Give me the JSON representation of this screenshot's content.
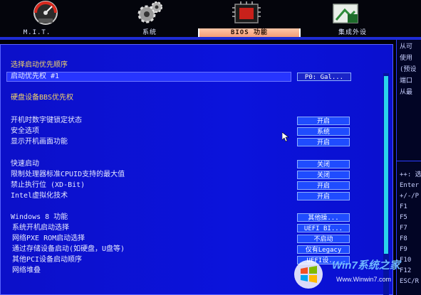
{
  "top_tabs": [
    {
      "label": "M.I.T.",
      "icon": "speedometer-icon"
    },
    {
      "label": "系统",
      "icon": "gears-icon"
    },
    {
      "label": "BIOS 功能",
      "icon": "chip-icon",
      "active": true
    },
    {
      "label": "集成外设",
      "icon": "peripherals-icon"
    }
  ],
  "main": {
    "boot_priority_heading": "选择启动优先顺序",
    "boot_option_1_label": "启动优先权 #1",
    "boot_option_1_value": "P0: Gal...",
    "hdd_bbs_priority": "硬盘设备BBS优先权",
    "settings_group1": [
      {
        "label": "开机时数字键锁定状态",
        "value": "开启"
      },
      {
        "label": "安全选项",
        "value": "系统"
      },
      {
        "label": "显示开机画面功能",
        "value": "开启"
      }
    ],
    "settings_group2": [
      {
        "label": "快速启动",
        "value": "关闭"
      },
      {
        "label": "限制处理器标准CPUID支持的最大值",
        "value": "关闭"
      },
      {
        "label": "禁止执行位 (XD-Bit)",
        "value": "开启"
      },
      {
        "label": "Intel虚拟化技术",
        "value": "开启"
      }
    ],
    "windows8_heading": "Windows 8 功能",
    "windows8_value": "其他操...",
    "settings_group3": [
      {
        "label": "系统开机启动选择",
        "value": "UEFI BI..."
      },
      {
        "label": "网络PXE ROM启动选择",
        "value": "不启动"
      },
      {
        "label": "通过存储设备启动(如硬盘，U盘等)",
        "value": "仅有Legacy"
      },
      {
        "label": "其他PCI设备启动顺序",
        "value": "UEFI设..."
      },
      {
        "label": "网络堆叠",
        "value": ""
      }
    ]
  },
  "help_panel": {
    "lines_top": [
      "从可",
      "使用",
      "(预设",
      "端口",
      "从最"
    ],
    "lines_bottom": [
      "++: 选",
      "Enter",
      "+/-/P",
      "F1",
      "F5",
      "F7",
      "F8",
      "F9",
      "F10",
      "F12",
      "ESC/R"
    ]
  },
  "watermark": {
    "brand": "Win7系统之家",
    "url": "Www.Winwin7.com"
  },
  "colors": {
    "panel_blue": "#0b13dc",
    "highlight_blue": "#2735ff",
    "value_button": "#1f4cff",
    "active_tab": "#f39a72",
    "heading_yellow": "#f2d46a",
    "scroll_thumb": "#2ad3ee"
  }
}
